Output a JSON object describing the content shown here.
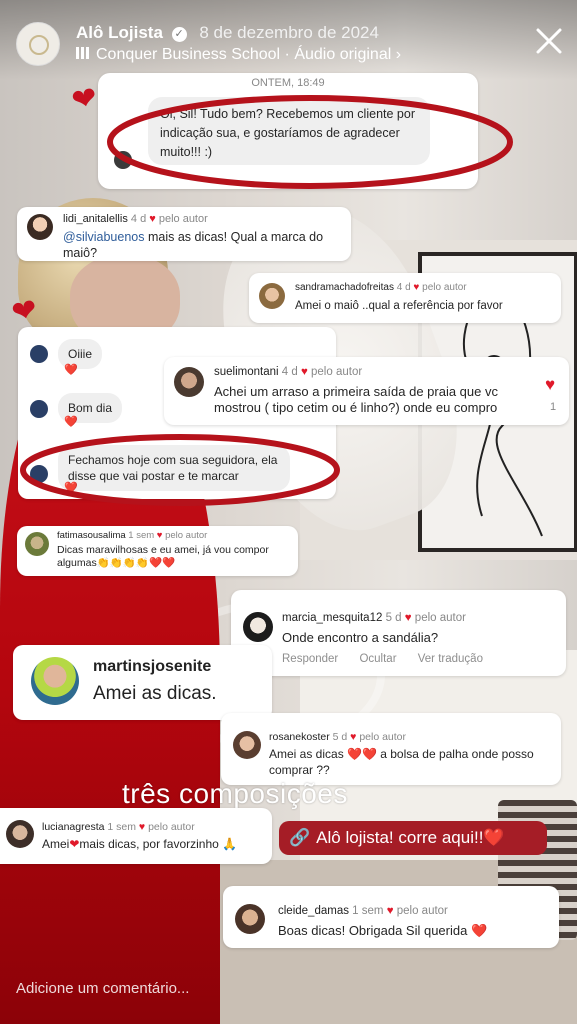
{
  "header": {
    "account_name": "Alô Lojista",
    "date": "8 de dezembro de 2024",
    "audio_label": "Conquer Business School · Áudio original ›",
    "close_icon": "close-icon",
    "verified_icon": "verified-badge-icon"
  },
  "dm_card": {
    "timestamp": "ONTEM, 18:49",
    "message": "Oi, Sil! Tudo bem? Recebemos um cliente por indicação sua, e gostaríamos de agradecer muito!!! :)"
  },
  "comments": [
    {
      "user": "lidi_anitalellis",
      "age": "4 d",
      "author_tag": "pelo autor",
      "mention": "@silviabuenos",
      "text": " mais as dicas! Qual a marca do maiô?"
    },
    {
      "user": "sandramachadofreitas",
      "age": "4 d",
      "author_tag": "pelo autor",
      "text": "Amei o maiô ..qual a referência por favor"
    },
    {
      "user": "suelimontani",
      "age": "4 d",
      "author_tag": "pelo autor",
      "text": "Achei um arraso a primeira saída de praia que vc mostrou ( tipo cetim ou é linho?) onde eu compro",
      "like_count": "1"
    },
    {
      "user": "fatimasousalima",
      "age": "1 sem",
      "author_tag": "pelo autor",
      "text": "Dicas maravilhosas e eu amei, já vou compor algumas👏👏👏👏❤️❤️"
    },
    {
      "user": "marcia_mesquita12",
      "age": "5 d",
      "author_tag": "pelo autor",
      "text": "Onde encontro a sandália?",
      "actions": [
        "Responder",
        "Ocultar",
        "Ver tradução"
      ]
    },
    {
      "user": "martinsjosenite",
      "text": "Amei as dicas."
    },
    {
      "user": "rosanekoster",
      "age": "5 d",
      "author_tag": "pelo autor",
      "text": "Amei as dicas ❤️❤️ a bolsa de palha onde posso comprar ??"
    },
    {
      "user": "lucianagresta",
      "age": "1 sem",
      "author_tag": "pelo autor",
      "text_a": "Amei",
      "text_b": "mais dicas, por favorzinho 🙏"
    },
    {
      "user": "cleide_damas",
      "age": "1 sem",
      "author_tag": "pelo autor",
      "text": "Boas dicas! Obrigada Sil querida ❤️"
    }
  ],
  "chat_card": {
    "messages": [
      "Oiiie",
      "Bom dia",
      "Fechamos hoje com sua seguidora, ela disse que vai postar e te marcar"
    ],
    "reaction": "❤️"
  },
  "caption": "três composições",
  "sticker_label": "Alô lojista! corre aqui!!❤️",
  "comment_placeholder": "Adicione um comentário...",
  "colors": {
    "heart": "#e0192a",
    "sticker_bg": "#a51d26",
    "highlight_oval": "#b5121b"
  }
}
